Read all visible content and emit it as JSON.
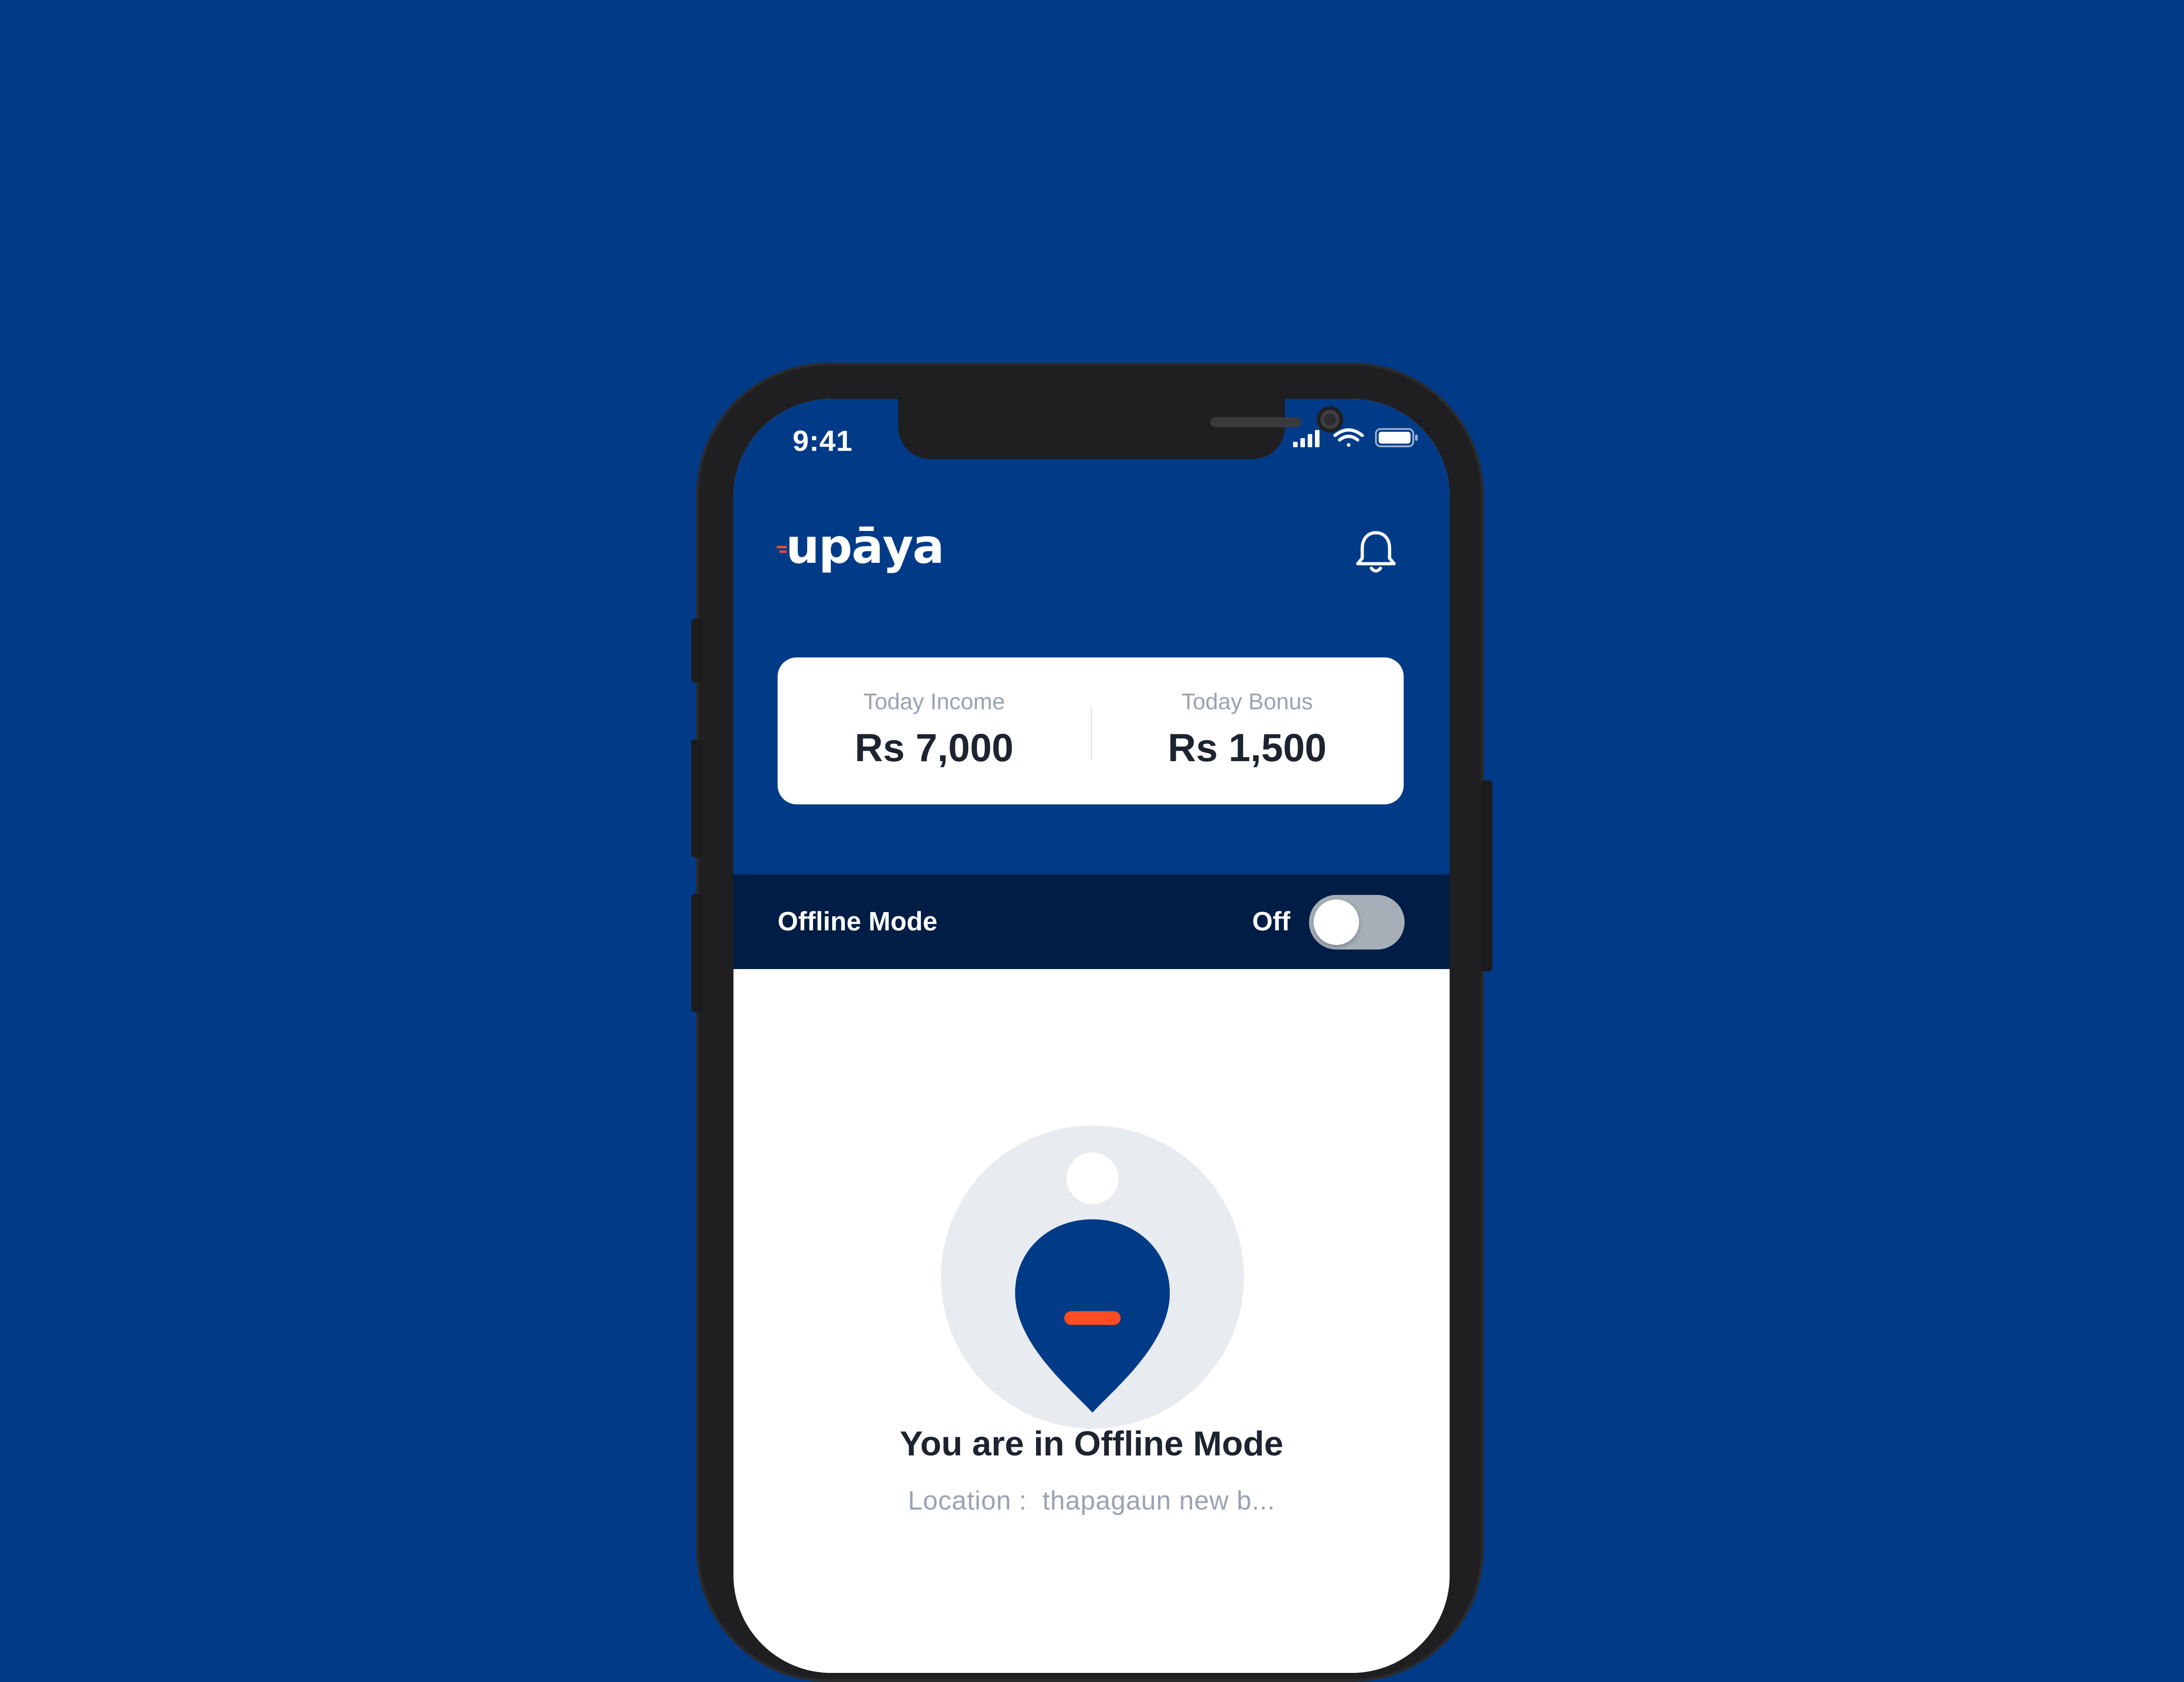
{
  "colors": {
    "background": "#013B88",
    "brand_blue": "#013B88",
    "offline_bar": "#001D45",
    "accent_orange": "#FF4C22",
    "muted_text": "#9AA3B3",
    "dark_text": "#1D2430"
  },
  "status_bar": {
    "time": "9:41",
    "icons": [
      "signal-icon",
      "wifi-icon",
      "battery-icon"
    ]
  },
  "header": {
    "logo_text": "upāya",
    "notification_icon": "bell-icon"
  },
  "stats": {
    "income_label": "Today Income",
    "income_value": "Rs 7,000",
    "bonus_label": "Today Bonus",
    "bonus_value": "Rs 1,500"
  },
  "offline_mode": {
    "label": "Offline Mode",
    "state_text": "Off",
    "toggle_on": false
  },
  "main": {
    "illustration_icon": "location-pin-icon",
    "title": "You are in Offline Mode",
    "location_label": "Location :",
    "location_value": "thapagaun new b..."
  }
}
